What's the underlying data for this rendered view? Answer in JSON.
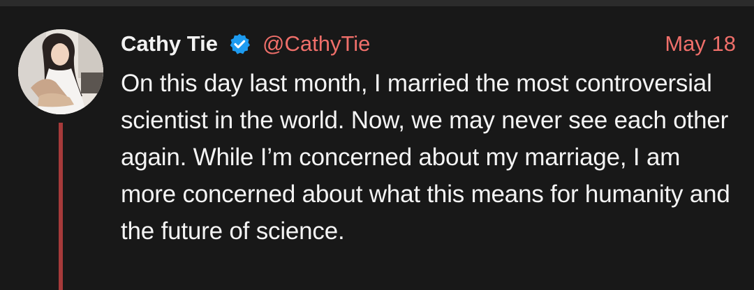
{
  "tweet": {
    "author": {
      "name": "Cathy Tie",
      "handle": "@CathyTie",
      "verified": true
    },
    "date": "May 18",
    "text": "On this day last month, I married the most controversial scientist in the world. Now, we may never see each other again. While I’m concerned about my marriage, I am more concerned about what this means for humanity and the future of science."
  },
  "colors": {
    "background": "#181818",
    "accent": "#ef6f6a",
    "thread_line": "#a63a3a",
    "verified_badge": "#1d9bf0",
    "text": "#f4f4f4"
  },
  "icons": {
    "verified": "verified-badge-icon"
  }
}
